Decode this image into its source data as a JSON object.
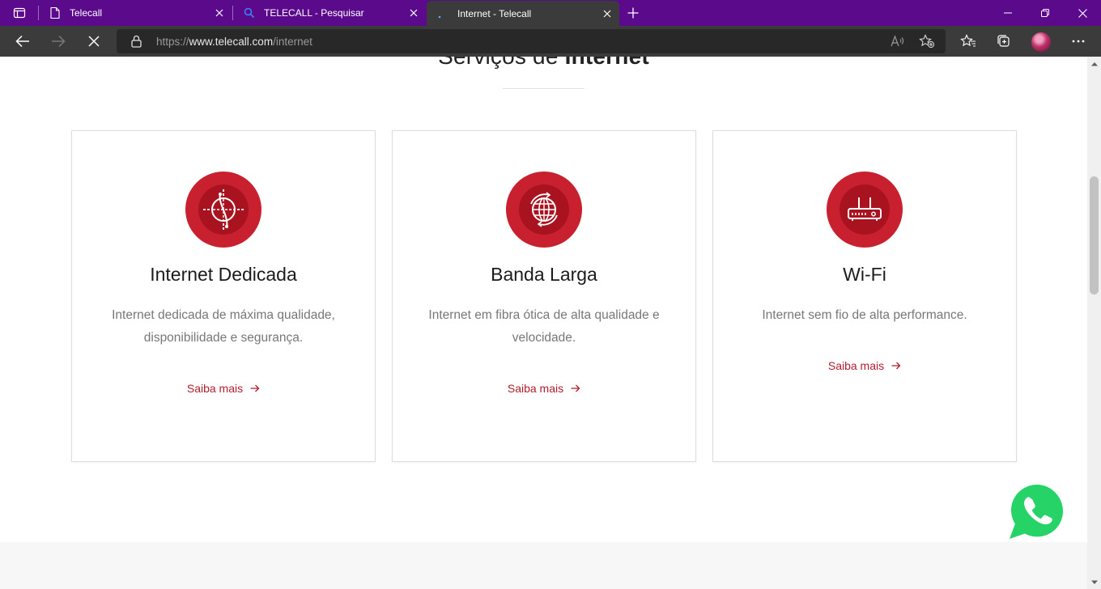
{
  "browser": {
    "tabs": [
      {
        "title": "Telecall",
        "icon": "page-icon"
      },
      {
        "title": "TELECALL - Pesquisar",
        "icon": "search-icon"
      },
      {
        "title": "Internet - Telecall",
        "icon": "loading-icon",
        "active": true
      }
    ],
    "address": {
      "scheme": "https://",
      "host": "www.telecall.com",
      "path": "/internet"
    },
    "colors": {
      "tabstrip": "#5b0a8c",
      "toolbar": "#3b3b3b"
    }
  },
  "section": {
    "title_light": "Serviços de",
    "title_bold": "Internet"
  },
  "services": [
    {
      "title": "Internet Dedicada",
      "description": "Internet dedicada de máxima qualidade, disponibilidade e segurança.",
      "link": "Saiba mais",
      "icon": "dedicated-internet-icon"
    },
    {
      "title": "Banda Larga",
      "description": "Internet em fibra ótica de alta qualidade e velocidade.",
      "link": "Saiba mais",
      "icon": "globe-icon"
    },
    {
      "title": "Wi-Fi",
      "description": "Internet sem fio de alta performance.",
      "link": "Saiba mais",
      "icon": "router-icon"
    }
  ],
  "colors": {
    "brand_red": "#c8202f",
    "link_red": "#b01e2d",
    "whatsapp_green": "#25d366"
  }
}
